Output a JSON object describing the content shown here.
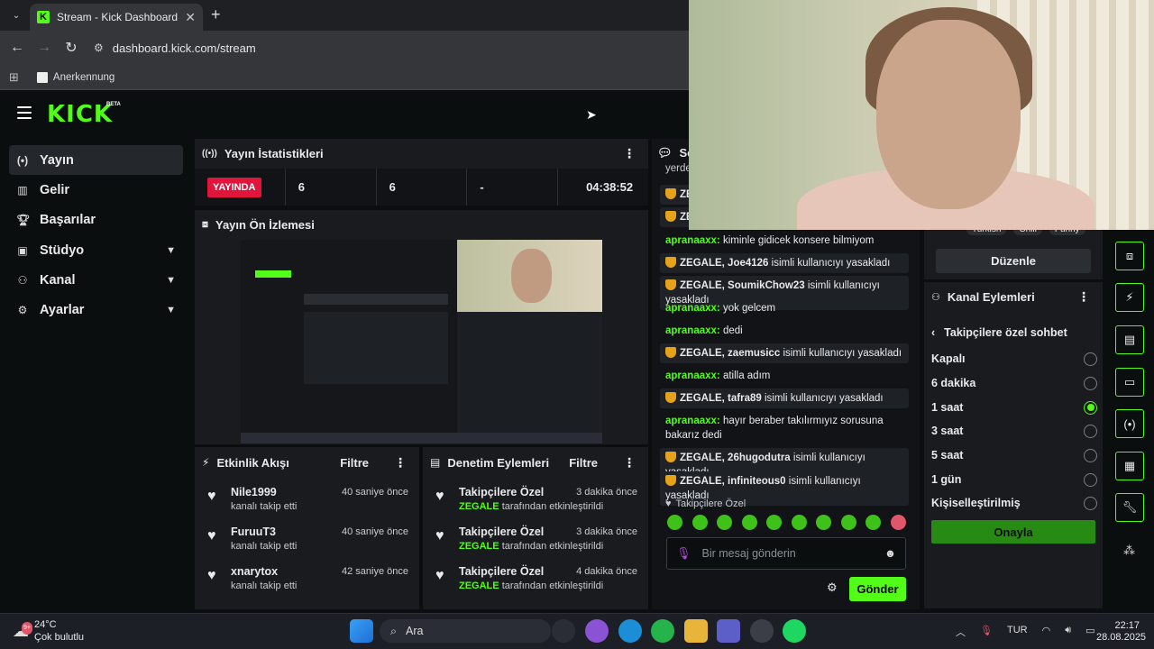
{
  "browser": {
    "tab_title": "Stream - Kick Dashboard",
    "tab_favicon": "K",
    "url": "dashboard.kick.com/stream",
    "bookmark": "Anerkennung"
  },
  "header": {
    "logo": "KICK",
    "beta": "BETA"
  },
  "sidebar": {
    "items": [
      {
        "label": "Yayın",
        "icon": "broadcast-icon"
      },
      {
        "label": "Gelir",
        "icon": "chart-icon"
      },
      {
        "label": "Başarılar",
        "icon": "trophy-icon"
      },
      {
        "label": "Stüdyo",
        "icon": "camera-icon"
      },
      {
        "label": "Kanal",
        "icon": "users-icon"
      },
      {
        "label": "Ayarlar",
        "icon": "gear-icon"
      }
    ]
  },
  "stats": {
    "title": "Yayın İstatistikleri",
    "status": "YAYINDA",
    "values": [
      "6",
      "6",
      "-",
      "04:38:52"
    ]
  },
  "preview": {
    "title": "Yayın Ön İzlemesi"
  },
  "events": {
    "title": "Etkinlik Akışı",
    "filter": "Filtre",
    "items": [
      {
        "name": "Nile1999",
        "sub": "kanalı takip etti",
        "time": "40 saniye önce"
      },
      {
        "name": "FuruuT3",
        "sub": "kanalı takip etti",
        "time": "40 saniye önce"
      },
      {
        "name": "xnarytox",
        "sub": "kanalı takip etti",
        "time": "42 saniye önce"
      }
    ]
  },
  "moderation": {
    "title": "Denetim Eylemleri",
    "filter": "Filtre",
    "items": [
      {
        "name": "Takipçilere Özel",
        "mod": "ZEGALE",
        "sub": "tarafından etkinleştirildi",
        "time": "3 dakika önce"
      },
      {
        "name": "Takipçilere Özel",
        "mod": "ZEGALE",
        "sub": "tarafından etkinleştirildi",
        "time": "3 dakika önce"
      },
      {
        "name": "Takipçilere Özel",
        "mod": "ZEGALE",
        "sub": "tarafından etkinleştirildi",
        "time": "4 dakika önce"
      }
    ]
  },
  "chat": {
    "title": "So",
    "top_fragment": "yerde",
    "messages": [
      {
        "type": "mod",
        "mod": "ZE",
        "user": "",
        "text": ""
      },
      {
        "type": "mod",
        "mod": "ZE",
        "user": "",
        "text": ""
      },
      {
        "type": "user",
        "user": "apranaaxx:",
        "text": "kiminle gidicek konsere bilmiyom"
      },
      {
        "type": "mod",
        "mod": "ZEGALE,",
        "user": "Joe4126",
        "text": "isimli kullanıcıyı yasakladı"
      },
      {
        "type": "mod",
        "mod": "ZEGALE,",
        "user": "SoumikChow23",
        "text": "isimli kullanıcıyı yasakladı"
      },
      {
        "type": "user",
        "user": "apranaaxx:",
        "text": "yok gelcem"
      },
      {
        "type": "user",
        "user": "apranaaxx:",
        "text": "dedi"
      },
      {
        "type": "mod",
        "mod": "ZEGALE,",
        "user": "zaemusicc",
        "text": "isimli kullanıcıyı yasakladı"
      },
      {
        "type": "user",
        "user": "apranaaxx:",
        "text": "atilla adım"
      },
      {
        "type": "mod",
        "mod": "ZEGALE,",
        "user": "tafra89",
        "text": "isimli kullanıcıyı yasakladı"
      },
      {
        "type": "user",
        "user": "apranaaxx:",
        "text": "hayır beraber takılırmıyız sorusuna bakarız dedi"
      },
      {
        "type": "mod",
        "mod": "ZEGALE,",
        "user": "26hugodutra",
        "text": "isimli kullanıcıyı yasakladı"
      },
      {
        "type": "mod",
        "mod": "ZEGALE,",
        "user": "infiniteous0",
        "text": "isimli kullanıcıyı yasakladı"
      }
    ],
    "mode_label": "Takipçilere Özel",
    "placeholder": "Bir mesaj gönderin",
    "send": "Gönder"
  },
  "right": {
    "edit": "Düzenle",
    "tags": [
      "Turkish",
      "Chill",
      "Funny"
    ],
    "actions_title": "Kanal Eylemleri",
    "sub_title": "Takipçilere özel sohbet",
    "options": [
      "Kapalı",
      "6 dakika",
      "1 saat",
      "3 saat",
      "5 saat",
      "1 gün",
      "Kişiselleştirilmiş"
    ],
    "selected": 2,
    "confirm": "Onayla"
  },
  "taskbar": {
    "temp": "24°C",
    "weather": "Çok bulutlu",
    "weather_badge": "9+",
    "search": "Ara",
    "lang": "TUR",
    "time": "22:17",
    "date": "28.08.2025"
  },
  "colors": {
    "accent": "#53fc18",
    "live": "#e1143c",
    "panel": "#191b1f",
    "bg": "#0b0e0f",
    "mod_shield": "#e6a21a"
  }
}
